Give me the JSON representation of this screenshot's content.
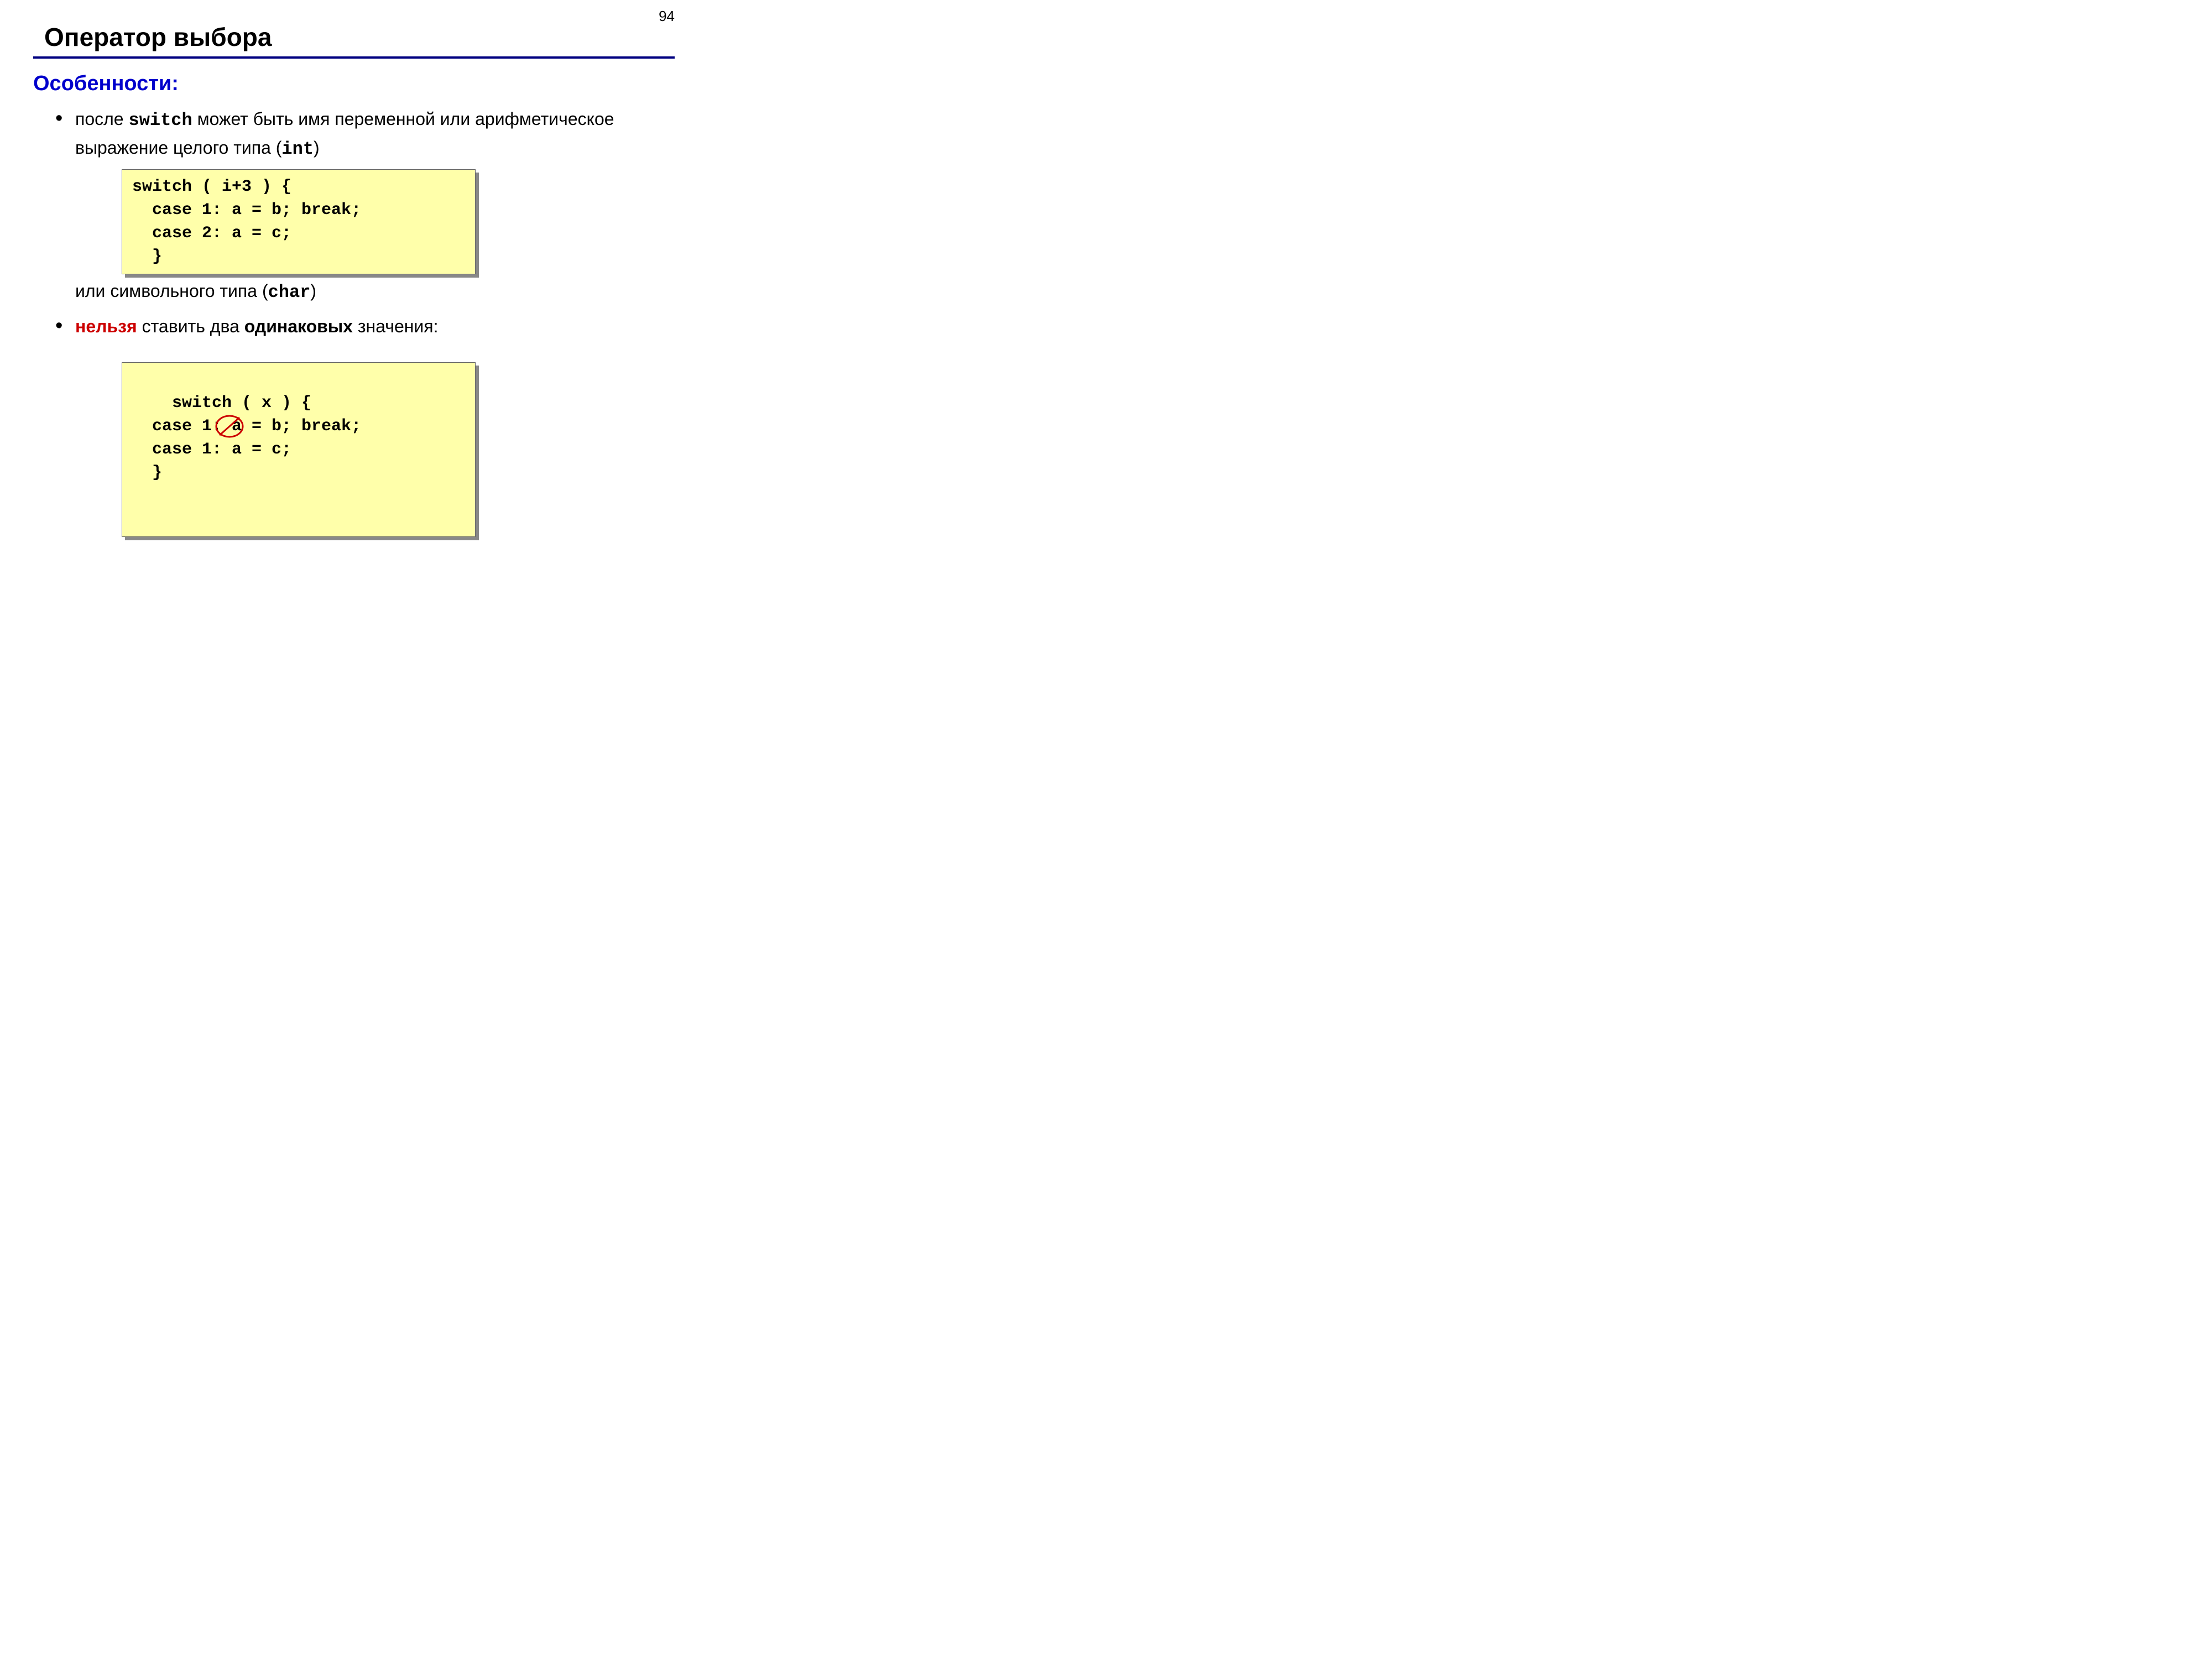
{
  "page_number": "94",
  "title": "Оператор выбора",
  "subhead": "Особенности:",
  "bullet1": {
    "pre": "после ",
    "kw1": "switch",
    "mid": " может быть имя переменной или арифметическое выражение целого типа (",
    "kw2": "int",
    "post": ")"
  },
  "code1": "switch ( i+3 ) {\n  case 1: a = b; break;\n  case 2: a = c;\n  }",
  "cont1": {
    "pre": "или символьного типа (",
    "kw": "char",
    "post": ")"
  },
  "bullet2": {
    "red": "нельзя",
    "mid": " ставить два ",
    "bold": "одинаковых",
    "post": " значения:"
  },
  "code2": "switch ( x ) {\n  case 1: a = b; break;\n  case 1: a = c;\n  }"
}
